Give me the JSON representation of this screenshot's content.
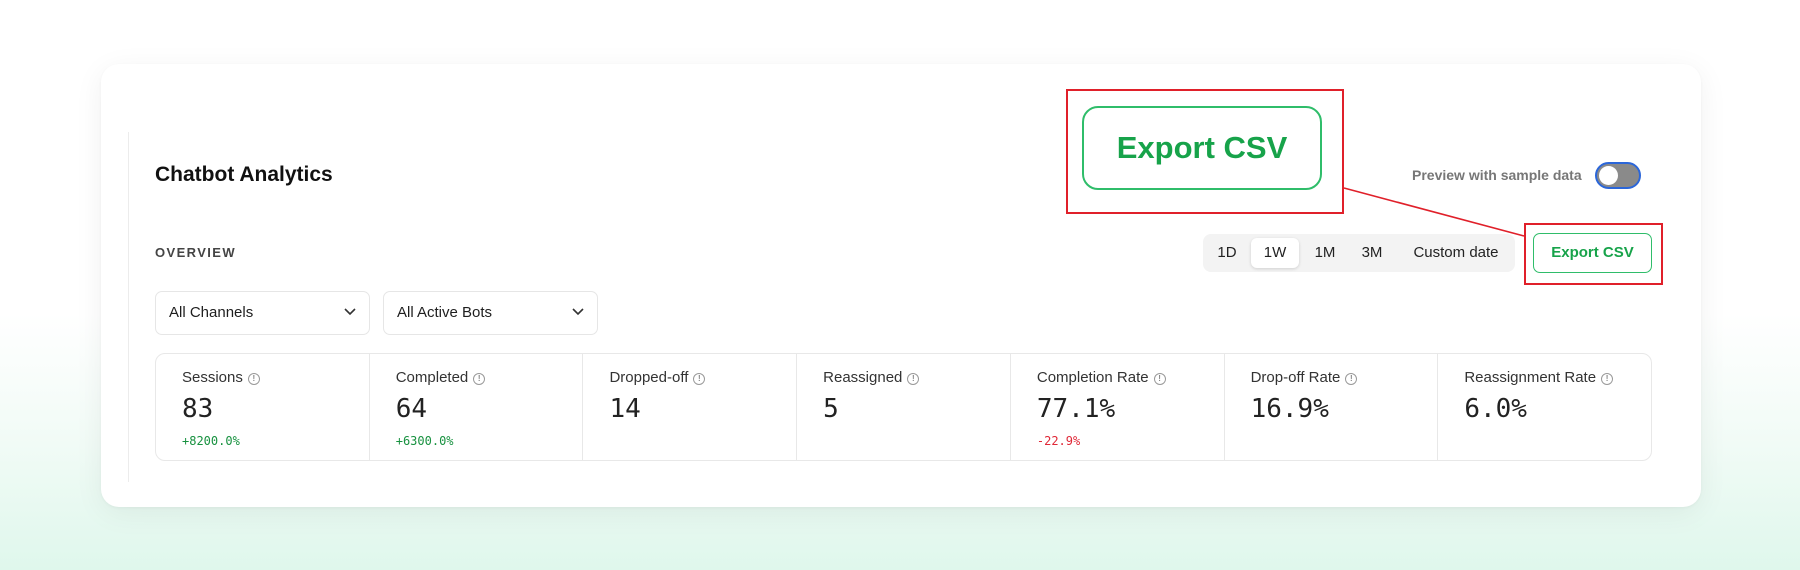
{
  "header": {
    "title": "Chatbot Analytics",
    "preview_label": "Preview with sample data",
    "preview_enabled": false
  },
  "overview": {
    "label": "OVERVIEW"
  },
  "ranges": [
    {
      "label": "1D",
      "active": false
    },
    {
      "label": "1W",
      "active": true
    },
    {
      "label": "1M",
      "active": false
    },
    {
      "label": "3M",
      "active": false
    },
    {
      "label": "Custom date",
      "active": false
    }
  ],
  "export": {
    "label": "Export CSV",
    "zoom_label": "Export CSV"
  },
  "filters": {
    "channels": "All Channels",
    "bots": "All Active Bots"
  },
  "metrics": [
    {
      "label": "Sessions",
      "value": "83",
      "delta": "+8200.0%",
      "trend": "up"
    },
    {
      "label": "Completed",
      "value": "64",
      "delta": "+6300.0%",
      "trend": "up"
    },
    {
      "label": "Dropped-off",
      "value": "14",
      "delta": "",
      "trend": ""
    },
    {
      "label": "Reassigned",
      "value": "5",
      "delta": "",
      "trend": ""
    },
    {
      "label": "Completion Rate",
      "value": "77.1%",
      "delta": "-22.9%",
      "trend": "down"
    },
    {
      "label": "Drop-off Rate",
      "value": "16.9%",
      "delta": "",
      "trend": ""
    },
    {
      "label": "Reassignment Rate",
      "value": "6.0%",
      "delta": "",
      "trend": ""
    }
  ],
  "icons": {
    "info": "info-icon",
    "dropdown": "chevron-down-icon"
  },
  "colors": {
    "accent_green": "#17a34a",
    "highlight_red": "#e0202a",
    "negative": "#e02837",
    "positive": "#17913f",
    "toggle_border": "#2b66d9"
  }
}
